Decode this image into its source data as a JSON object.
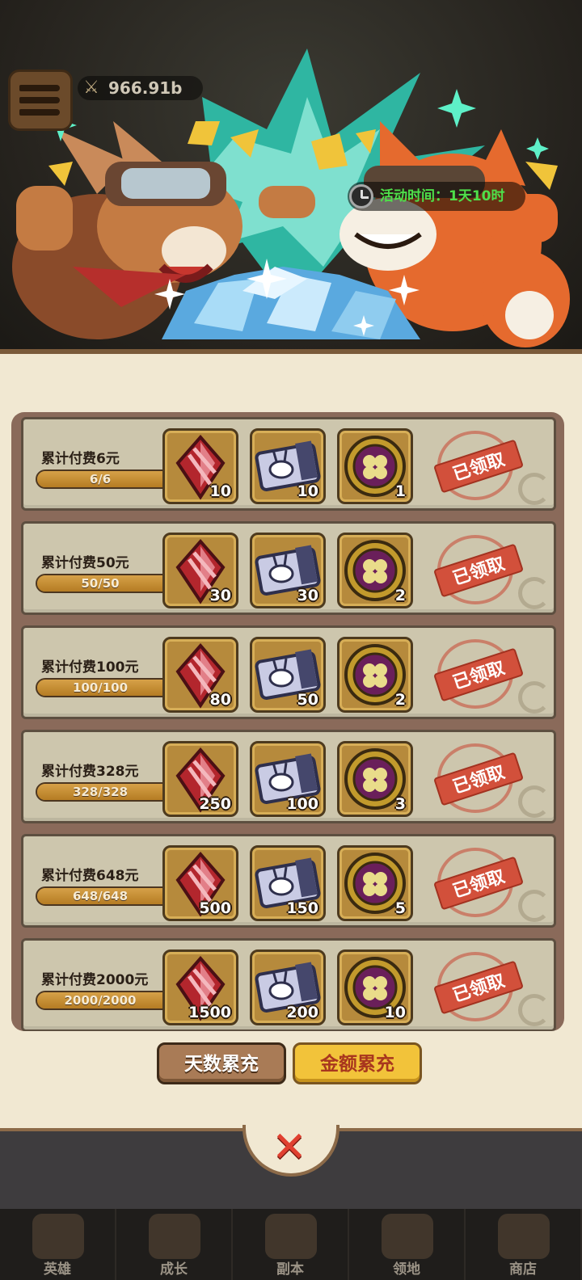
{
  "header": {
    "power_value": "966.91b",
    "timer_text": "活动时间：1天10时"
  },
  "rows": [
    {
      "title": "累计付费6元",
      "progress": "6/6",
      "progress_fraction": 1.0,
      "rewards": [
        {
          "icon": "ruby-gem-icon",
          "qty": "10"
        },
        {
          "icon": "rabbit-ticket-icon",
          "qty": "10"
        },
        {
          "icon": "clover-coin-icon",
          "qty": "1"
        }
      ],
      "status": "已领取"
    },
    {
      "title": "累计付费50元",
      "progress": "50/50",
      "progress_fraction": 1.0,
      "rewards": [
        {
          "icon": "ruby-gem-icon",
          "qty": "30"
        },
        {
          "icon": "rabbit-ticket-icon",
          "qty": "30"
        },
        {
          "icon": "clover-coin-icon",
          "qty": "2"
        }
      ],
      "status": "已领取"
    },
    {
      "title": "累计付费100元",
      "progress": "100/100",
      "progress_fraction": 1.0,
      "rewards": [
        {
          "icon": "ruby-gem-icon",
          "qty": "80"
        },
        {
          "icon": "rabbit-ticket-icon",
          "qty": "50"
        },
        {
          "icon": "clover-coin-icon",
          "qty": "2"
        }
      ],
      "status": "已领取"
    },
    {
      "title": "累计付费328元",
      "progress": "328/328",
      "progress_fraction": 1.0,
      "rewards": [
        {
          "icon": "ruby-gem-icon",
          "qty": "250"
        },
        {
          "icon": "rabbit-ticket-icon",
          "qty": "100"
        },
        {
          "icon": "clover-coin-icon",
          "qty": "3"
        }
      ],
      "status": "已领取"
    },
    {
      "title": "累计付费648元",
      "progress": "648/648",
      "progress_fraction": 1.0,
      "rewards": [
        {
          "icon": "ruby-gem-icon",
          "qty": "500"
        },
        {
          "icon": "rabbit-ticket-icon",
          "qty": "150"
        },
        {
          "icon": "clover-coin-icon",
          "qty": "5"
        }
      ],
      "status": "已领取"
    },
    {
      "title": "累计付费2000元",
      "progress": "2000/2000",
      "progress_fraction": 1.0,
      "rewards": [
        {
          "icon": "ruby-gem-icon",
          "qty": "1500"
        },
        {
          "icon": "rabbit-ticket-icon",
          "qty": "200"
        },
        {
          "icon": "clover-coin-icon",
          "qty": "10"
        }
      ],
      "status": "已领取"
    }
  ],
  "tabs": {
    "days": "天数累充",
    "amount": "金额累充",
    "active": "amount"
  },
  "close": {
    "icon": "close-x-icon",
    "glyph": "✕"
  },
  "nav": [
    {
      "label": "英雄",
      "icon": "hero-icon"
    },
    {
      "label": "成长",
      "icon": "growth-icon"
    },
    {
      "label": "副本",
      "icon": "dungeon-icon"
    },
    {
      "label": "领地",
      "icon": "territory-icon"
    },
    {
      "label": "商店",
      "icon": "shop-icon"
    }
  ],
  "colors": {
    "panel_bg": "#f1e8d2",
    "row_bg": "#cdc6ad",
    "progress_fill": "#c69034",
    "stamp_red": "#d2503b",
    "timer_green": "#4ee04a",
    "tab_active": "#f2c33a"
  }
}
